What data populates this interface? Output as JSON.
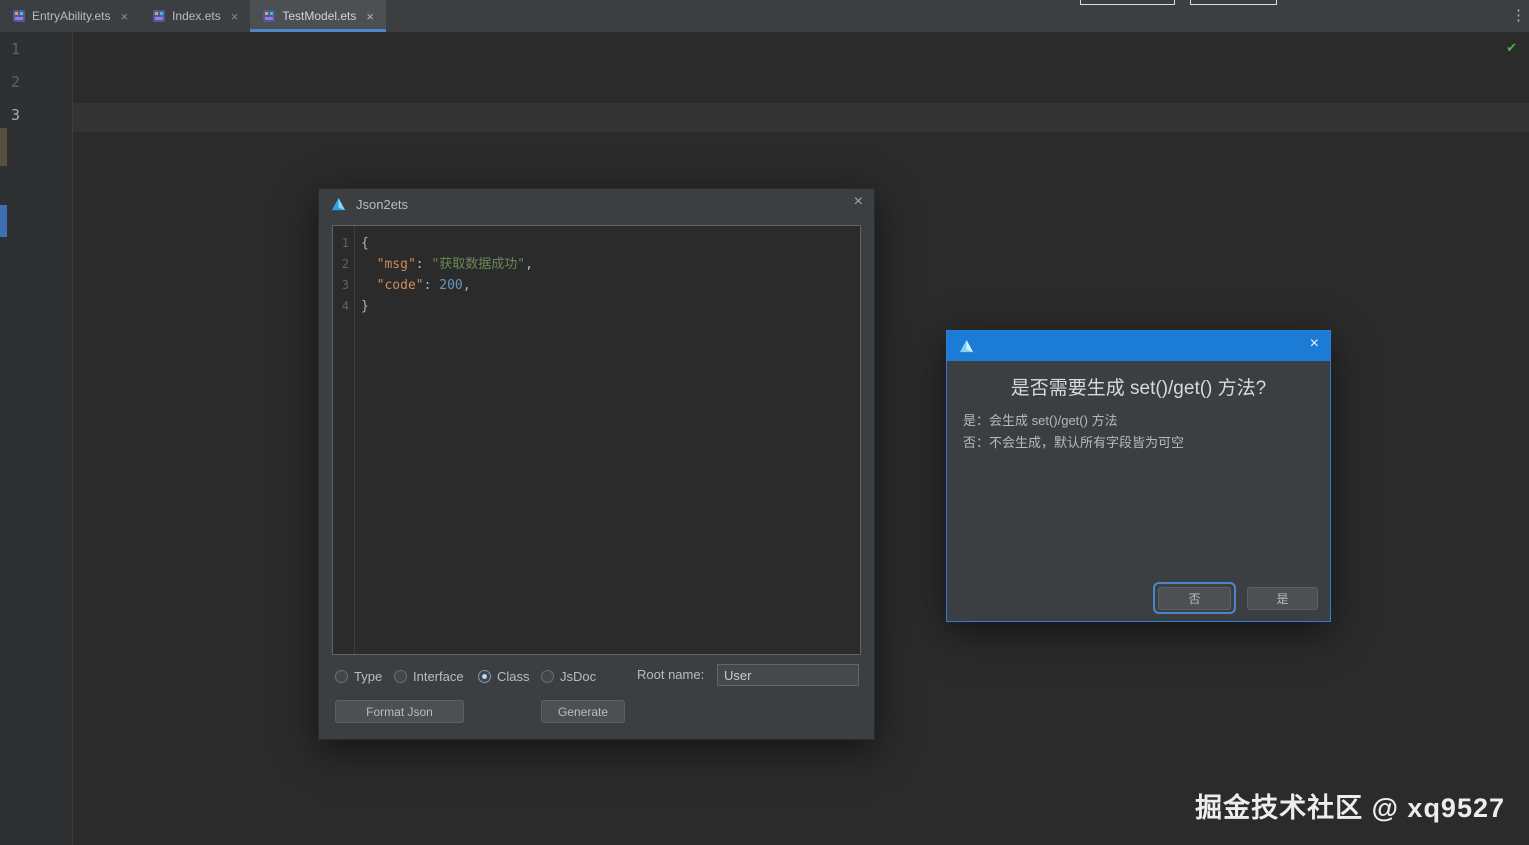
{
  "icons": {
    "close": "×",
    "kebab": "⋮",
    "check": "✔"
  },
  "tab_bar": {
    "tabs": [
      {
        "label": "EntryAbility.ets"
      },
      {
        "label": "Index.ets"
      },
      {
        "label": "TestModel.ets"
      }
    ]
  },
  "editor": {
    "line_numbers": [
      "1",
      "2",
      "3"
    ]
  },
  "json2ets_dialog": {
    "title": "Json2ets",
    "code": {
      "line_numbers": [
        "1",
        "2",
        "3",
        "4"
      ],
      "l1_brace": "{",
      "l2_key": "  \"msg\"",
      "l2_colon": ": ",
      "l2_string": "\"获取数据成功\"",
      "l2_comma": ",",
      "l3_key": "  \"code\"",
      "l3_colon": ": ",
      "l3_number": "200",
      "l3_comma": ",",
      "l4_brace": "}"
    },
    "options": [
      {
        "label": "Type"
      },
      {
        "label": "Interface"
      },
      {
        "label": "Class"
      },
      {
        "label": "JsDoc"
      }
    ],
    "selected_option": "Class",
    "root_name_label": "Root name:",
    "root_name_value": "User",
    "format_json_button": "Format Json",
    "generate_button": "Generate"
  },
  "confirm_dialog": {
    "title": "是否需要生成 set()/get() 方法?",
    "yes_desc": "是：会生成 set()/get() 方法",
    "no_desc": "否：不会生成，默认所有字段皆为可空",
    "no_button": "否",
    "yes_button": "是"
  },
  "watermark": "掘金技术社区 @ xq9527",
  "colors": {
    "accent_blue": "#4a88c7",
    "confirm_titlebar_blue": "#1b7bd5",
    "json_key": "#cc8c5c",
    "json_string": "#6a8759",
    "json_number": "#6897bb",
    "check_green": "#4db050"
  }
}
